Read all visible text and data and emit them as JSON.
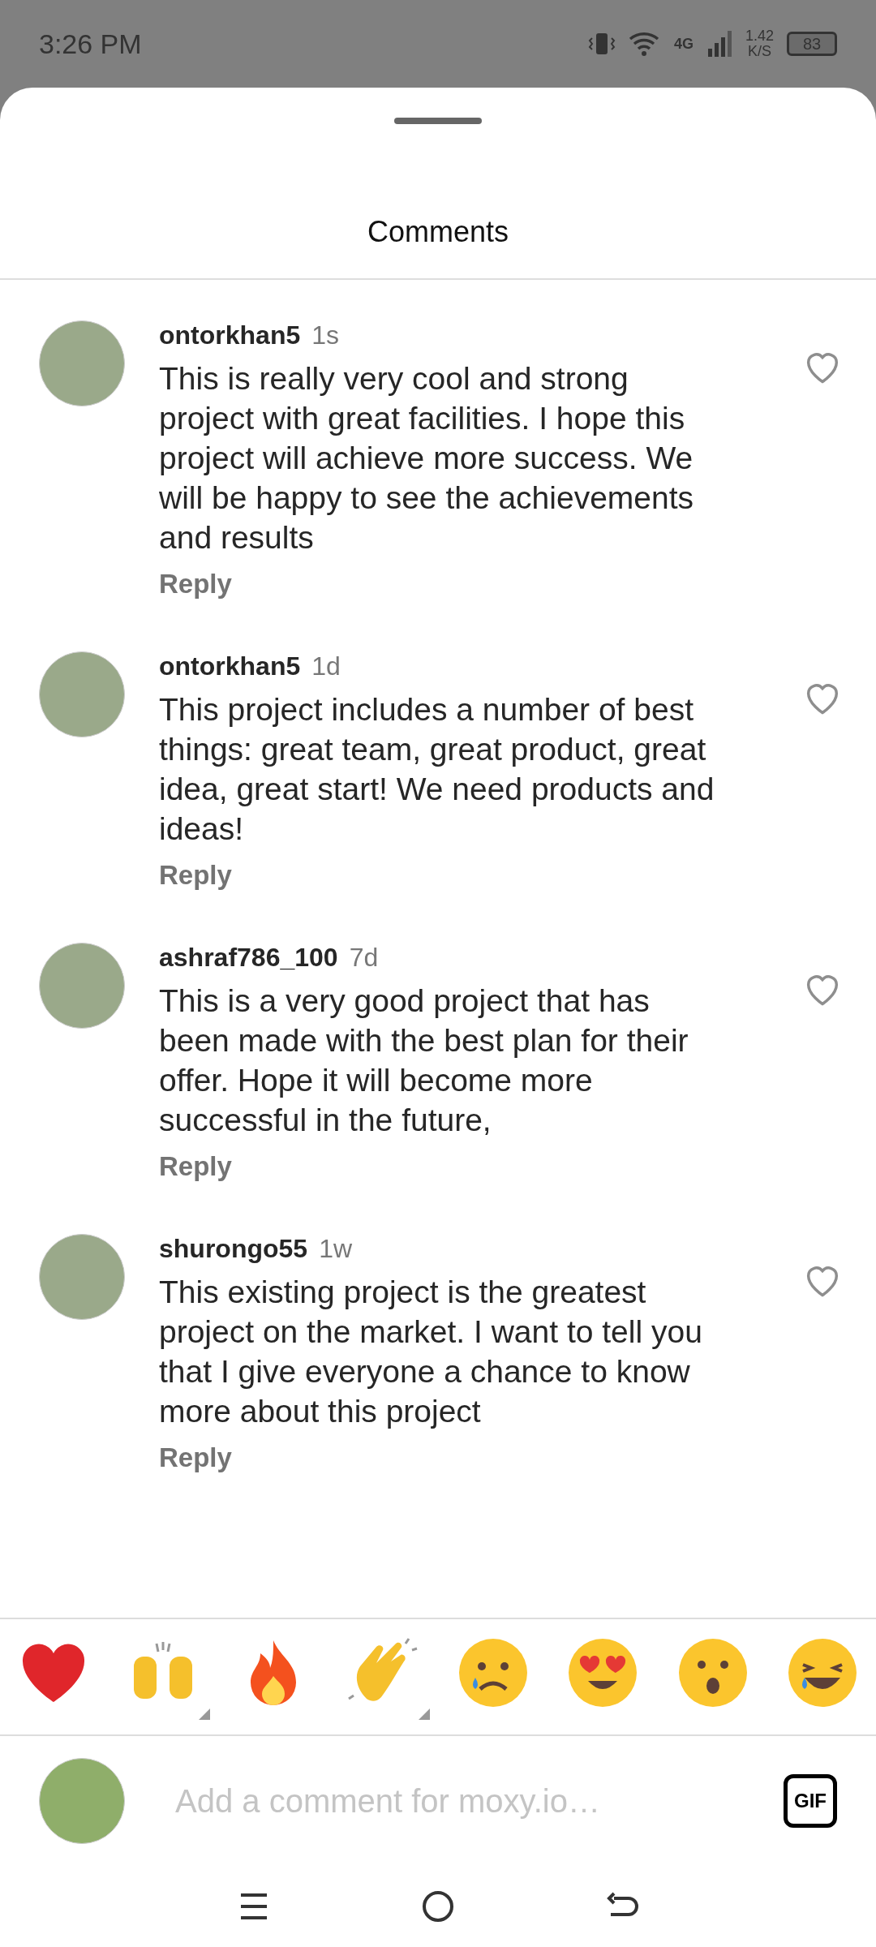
{
  "status_bar": {
    "time": "3:26 PM",
    "network": "4G",
    "speed_value": "1.42",
    "speed_unit": "K/S",
    "battery": "83"
  },
  "sheet": {
    "title": "Comments"
  },
  "comments": [
    {
      "username": "ontorkhan5",
      "age": "1s",
      "text": "This is really very cool and strong project with great facilities. I hope this project will achieve more success. We will be happy to see the achievements and results",
      "reply": "Reply",
      "liked": false
    },
    {
      "username": "ontorkhan5",
      "age": "1d",
      "text": "This project includes a number of best things: great team, great product, great idea, great start! We need products and ideas!",
      "reply": "Reply",
      "liked": false
    },
    {
      "username": "ashraf786_100",
      "age": "7d",
      "text": "This is a very good project that has been made with the best plan for their offer. Hope it will become more successful in the future,",
      "reply": "Reply",
      "liked": false
    },
    {
      "username": "shurongo55",
      "age": "1w",
      "text": "This existing project is the greatest project on the market.  I want to tell you that I give everyone a chance to know more about this project",
      "reply": "Reply",
      "liked": false
    }
  ],
  "reactions": [
    {
      "kind": "heart",
      "more": false
    },
    {
      "kind": "raised-hands",
      "more": true
    },
    {
      "kind": "fire",
      "more": false
    },
    {
      "kind": "clap",
      "more": true
    },
    {
      "kind": "crying",
      "more": false
    },
    {
      "kind": "heart-eyes",
      "more": false
    },
    {
      "kind": "surprised",
      "more": false
    },
    {
      "kind": "laughing",
      "more": false
    }
  ],
  "composer": {
    "placeholder": "Add a comment for moxy.io…",
    "gif_label": "GIF"
  }
}
